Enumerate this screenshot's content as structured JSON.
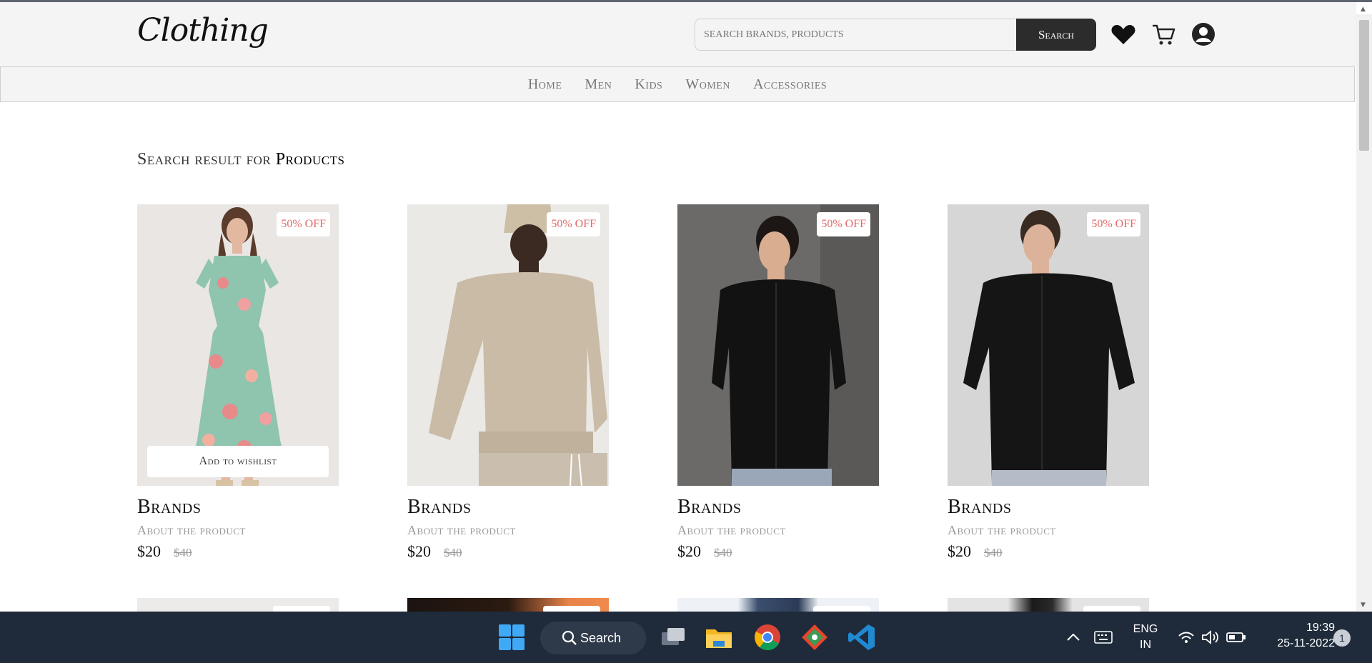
{
  "header": {
    "logo": "Clothing",
    "search_placeholder": "SEARCH BRANDS, PRODUCTS",
    "search_button": "Search"
  },
  "nav": {
    "items": [
      "Home",
      "Men",
      "Kids",
      "Women",
      "Accessories"
    ]
  },
  "results": {
    "prefix": "Search result for",
    "query": "Products"
  },
  "products": [
    {
      "badge": "50% OFF",
      "brand": "Brands",
      "about": "About the product",
      "price": "$20",
      "old_price": "$40",
      "wishlist": "Add to wishlist"
    },
    {
      "badge": "50% OFF",
      "brand": "Brands",
      "about": "About the product",
      "price": "$20",
      "old_price": "$40"
    },
    {
      "badge": "50% OFF",
      "brand": "Brands",
      "about": "About the product",
      "price": "$20",
      "old_price": "$40"
    },
    {
      "badge": "50% OFF",
      "brand": "Brands",
      "about": "About the product",
      "price": "$20",
      "old_price": "$40"
    }
  ],
  "taskbar": {
    "search": "Search",
    "lang_top": "ENG",
    "lang_bottom": "IN",
    "time": "19:39",
    "date": "25-11-2022",
    "notifications": "1"
  },
  "colors": {
    "dark_button": "#2c2c2c",
    "badge_text": "#e06a6a",
    "taskbar": "#1f2b3a"
  }
}
